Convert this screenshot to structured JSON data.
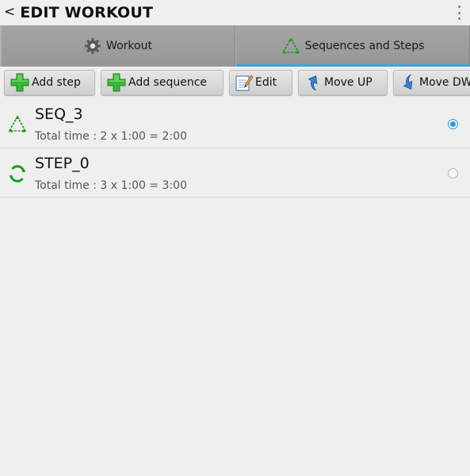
{
  "actionbar": {
    "back_glyph": "<",
    "title": "EDIT WORKOUT",
    "overflow_icon": "overflow-menu-icon"
  },
  "tabs": [
    {
      "label": "Workout",
      "icon": "gear-icon",
      "active": false
    },
    {
      "label": "Sequences and Steps",
      "icon": "recycle-icon",
      "active": true
    }
  ],
  "toolbar": {
    "add_step": "Add step",
    "add_sequence": "Add sequence",
    "edit": "Edit",
    "move_up": "Move UP",
    "move_down": "Move DWN"
  },
  "list": [
    {
      "name": "SEQ_3",
      "total": "Total time : 2 x 1:00 = 2:00",
      "icon": "sequence-icon",
      "selected": true
    },
    {
      "name": "STEP_0",
      "total": "Total time : 3 x 1:00 = 3:00",
      "icon": "step-icon",
      "selected": false
    }
  ],
  "colors": {
    "accent": "#3aa6dd",
    "radio": "#2d9bd0",
    "icon_green": "#1f9b1f"
  }
}
